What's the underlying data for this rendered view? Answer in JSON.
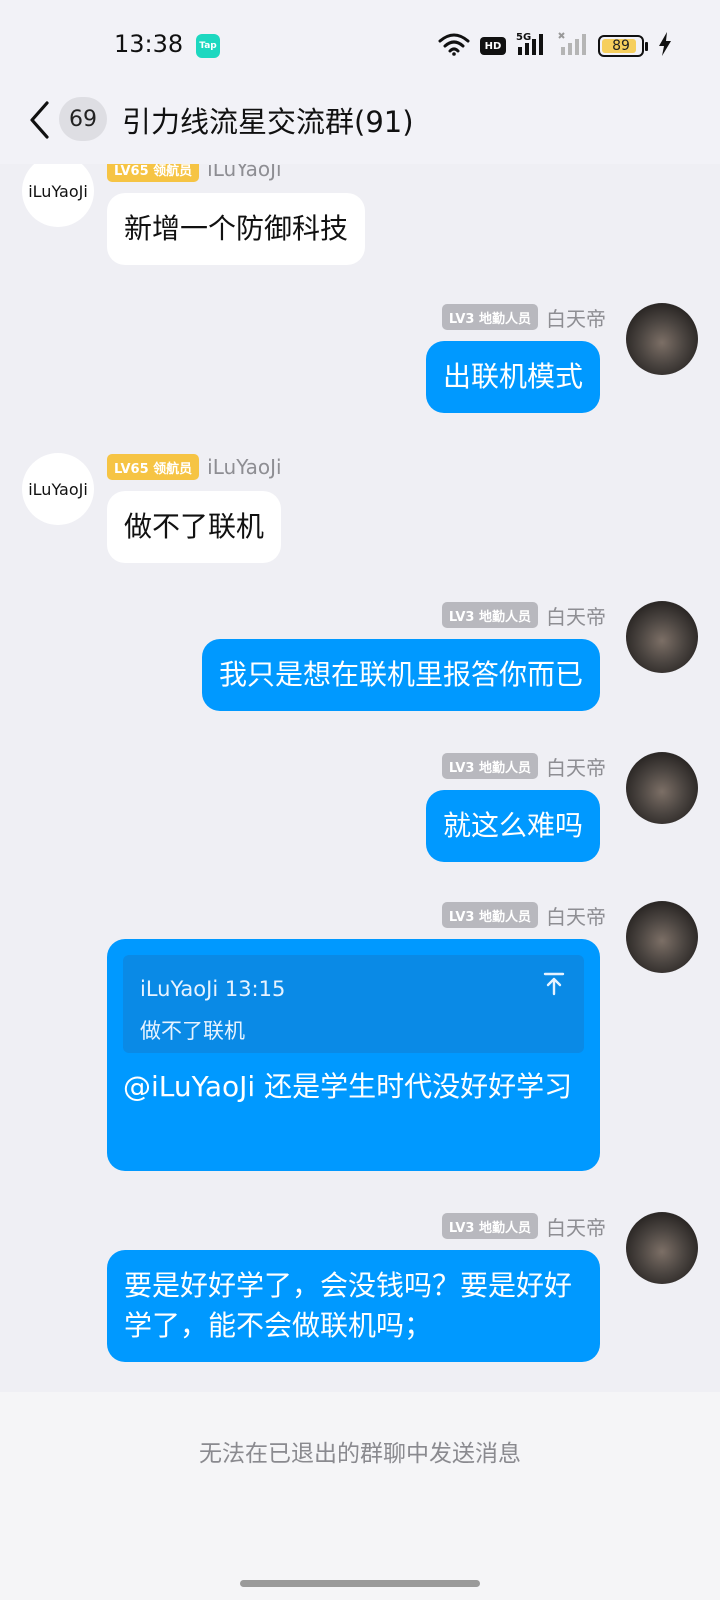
{
  "status_bar": {
    "time": "13:38",
    "app_icon_label": "Tap",
    "icons": [
      "wifi-icon",
      "hd-icon",
      "5g-signal-icon",
      "signal-icon",
      "battery-icon",
      "charging-icon"
    ],
    "hd_label": "HD",
    "network_label": "5G",
    "battery_level": "89",
    "battery_fraction": 0.89
  },
  "nav": {
    "unread_count": "69",
    "title": "引力线流星交流群(91)"
  },
  "messages": [
    {
      "side": "left",
      "avatar_text": "iLuYaoJi",
      "level": "LV65 领航员",
      "sender": "iLuYaoJi",
      "text": "新增一个防御科技"
    },
    {
      "side": "right",
      "level": "LV3 地勤人员",
      "sender": "白天帝",
      "text": "出联机模式"
    },
    {
      "side": "left",
      "avatar_text": "iLuYaoJi",
      "level": "LV65 领航员",
      "sender": "iLuYaoJi",
      "text": "做不了联机"
    },
    {
      "side": "right",
      "level": "LV3 地勤人员",
      "sender": "白天帝",
      "text": "我只是想在联机里报答你而已"
    },
    {
      "side": "right",
      "level": "LV3 地勤人员",
      "sender": "白天帝",
      "text": "就这么难吗"
    },
    {
      "side": "right",
      "level": "LV3 地勤人员",
      "sender": "白天帝",
      "quote": {
        "header": "iLuYaoJi 13:15",
        "text": "做不了联机"
      },
      "text": "@iLuYaoJi 还是学生时代没好好学习"
    },
    {
      "side": "right",
      "level": "LV3 地勤人员",
      "sender": "白天帝",
      "text": "要是好好学了，会没钱吗？要是好好学了，能不会做联机吗；"
    }
  ],
  "bottom": {
    "notice": "无法在已退出的群聊中发送消息"
  },
  "colors": {
    "outgoing_bubble": "#0099FF",
    "incoming_bubble": "#FFFFFF",
    "level_gold": "#F6C444",
    "level_gray": "#B8B8BE",
    "background": "#EFEFF4"
  }
}
